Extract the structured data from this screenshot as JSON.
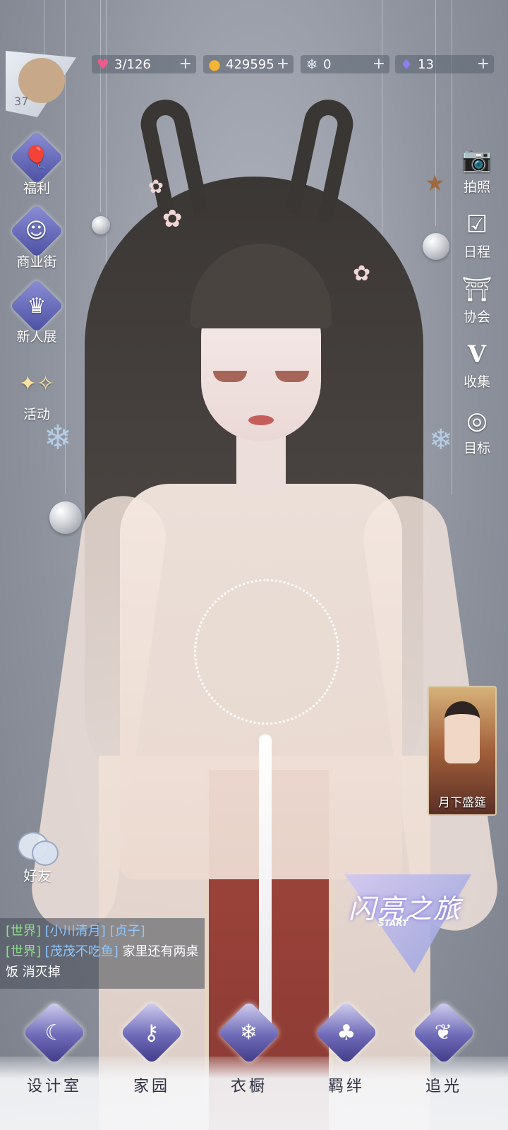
{
  "resources": {
    "stamina": {
      "icon": "heart-gem-icon",
      "value": "3/126"
    },
    "gold": {
      "icon": "gold-coin-icon",
      "value": "429595"
    },
    "crystal": {
      "icon": "snowflake-crystal-icon",
      "value": "0"
    },
    "diamond": {
      "icon": "diamond-icon",
      "value": "13"
    }
  },
  "player": {
    "level": "37"
  },
  "left_menu": [
    {
      "icon": "balloon-icon",
      "label": "福利"
    },
    {
      "icon": "shopping-bag-icon",
      "label": "商业街"
    },
    {
      "icon": "crown-icon",
      "label": "新人展"
    },
    {
      "icon": "sparkle-stars-icon",
      "label": "活动"
    }
  ],
  "right_menu": [
    {
      "icon": "camera-icon",
      "label": "拍照"
    },
    {
      "icon": "calendar-check-icon",
      "label": "日程"
    },
    {
      "icon": "guild-building-icon",
      "label": "协会"
    },
    {
      "icon": "collection-v-icon",
      "label": "收集"
    },
    {
      "icon": "target-heart-icon",
      "label": "目标"
    }
  ],
  "event_card": {
    "label": "月下盛筵"
  },
  "start_badge": {
    "title": "闪亮之旅",
    "sub": "START"
  },
  "friends": {
    "label": "好友"
  },
  "chat": [
    {
      "channel": "[世界]",
      "name": "[小川清月]",
      "text": "[贞子]"
    },
    {
      "channel": "[世界]",
      "name": "[茂茂不吃鱼]",
      "text": "家里还有两桌饭 消灭掉"
    }
  ],
  "bottom_nav": [
    {
      "icon": "moon-gem-icon",
      "label": "设计室"
    },
    {
      "icon": "key-gem-icon",
      "label": "家园"
    },
    {
      "icon": "snowflake-gem-icon",
      "label": "衣橱"
    },
    {
      "icon": "clover-gem-icon",
      "label": "羁绊"
    },
    {
      "icon": "butterfly-gem-icon",
      "label": "追光"
    }
  ]
}
